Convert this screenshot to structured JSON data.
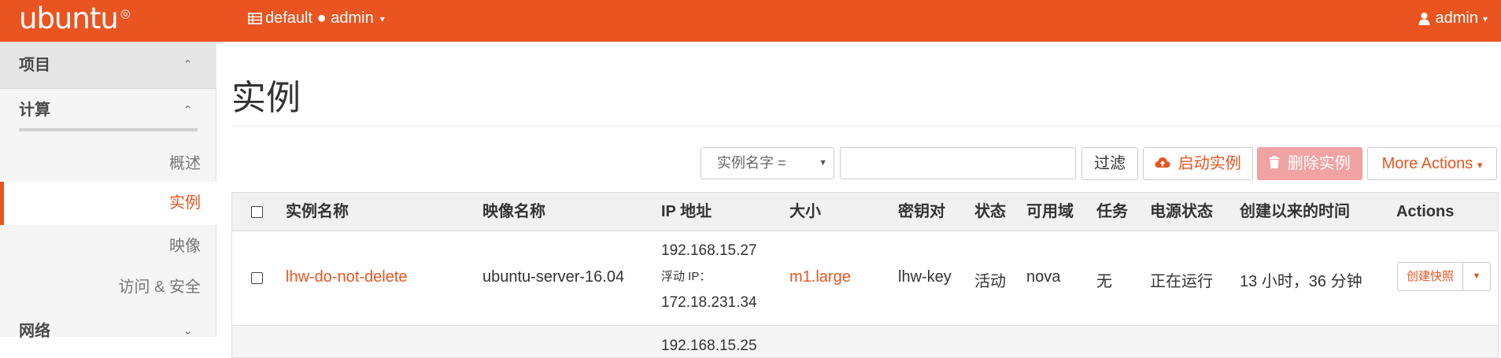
{
  "topbar": {
    "brand": "ubuntu",
    "brand_mark": "◎",
    "project_icon": "table-icon",
    "project_label": "default ● admin",
    "project_caret": "▾",
    "user_icon": "user-icon",
    "user_label": "admin",
    "user_caret": "▾",
    "color": "#e95420"
  },
  "sidebar": {
    "project_label": "项目",
    "compute_label": "计算",
    "overview_label": "概述",
    "instances_label": "实例",
    "images_label": "映像",
    "access_label": "访问 & 安全",
    "network_label": "网络",
    "chev_up": "⌃",
    "chev_down": "⌄"
  },
  "page": {
    "title": "实例"
  },
  "toolbar": {
    "filter_select_value": "实例名字 =",
    "filter_select_arrow": "▼",
    "filter_input_value": "",
    "filter_button": "过滤",
    "launch_button": "启动实例",
    "launch_icon": "cloud-upload-icon",
    "delete_button": "删除实例",
    "delete_icon": "trash-icon",
    "more_button": "More Actions",
    "more_caret": "▾"
  },
  "table": {
    "headers": [
      "实例名称",
      "映像名称",
      "IP 地址",
      "大小",
      "密钥对",
      "状态",
      "可用域",
      "任务",
      "电源状态",
      "创建以来的时间",
      "Actions"
    ],
    "rows": [
      {
        "name": "lhw-do-not-delete",
        "image": "ubuntu-server-16.04",
        "ip_fixed": "192.168.15.27",
        "ip_floating_label": "浮动 IP：",
        "ip_floating": "172.18.231.34",
        "size": "m1.large",
        "keypair": "lhw-key",
        "status": "活动",
        "az": "nova",
        "task": "无",
        "power": "正在运行",
        "age": "13 小时，36 分钟",
        "action": "创建快照",
        "action_caret": "▼"
      }
    ],
    "next_row_partial_ip": "192.168.15.25"
  }
}
